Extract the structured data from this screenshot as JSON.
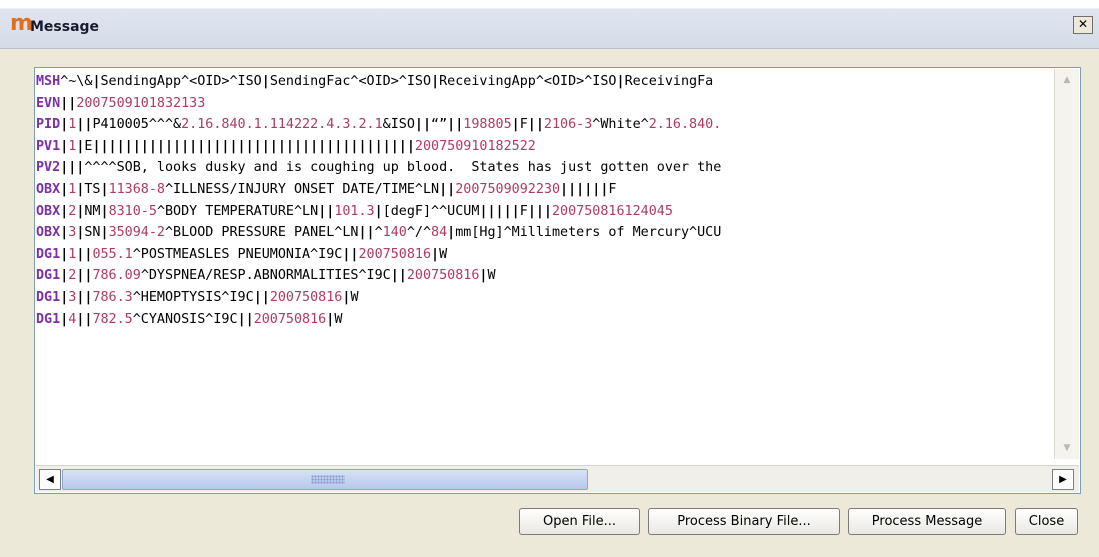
{
  "window": {
    "title": "Message",
    "app_glyph": "m",
    "close_glyph": "✕"
  },
  "message_lines": [
    {
      "seg": "MSH",
      "parts": [
        [
          "t",
          "^~\\&"
        ],
        [
          "s",
          "|"
        ],
        [
          "t",
          "SendingApp^<OID>^ISO"
        ],
        [
          "s",
          "|"
        ],
        [
          "t",
          "SendingFac^<OID>^ISO"
        ],
        [
          "s",
          "|"
        ],
        [
          "t",
          "ReceivingApp^<OID>^ISO"
        ],
        [
          "s",
          "|"
        ],
        [
          "t",
          "ReceivingFa"
        ]
      ]
    },
    {
      "seg": "EVN",
      "parts": [
        [
          "s",
          "||"
        ],
        [
          "n",
          "2007509101832133"
        ]
      ]
    },
    {
      "seg": "PID",
      "parts": [
        [
          "s",
          "|"
        ],
        [
          "n",
          "1"
        ],
        [
          "s",
          "||"
        ],
        [
          "t",
          "P410005^^^&"
        ],
        [
          "n",
          "2.16.840.1.114222.4.3.2.1"
        ],
        [
          "t",
          "&ISO"
        ],
        [
          "s",
          "||"
        ],
        [
          "t",
          "“”"
        ],
        [
          "s",
          "||"
        ],
        [
          "n",
          "198805"
        ],
        [
          "s",
          "|"
        ],
        [
          "t",
          "F"
        ],
        [
          "s",
          "||"
        ],
        [
          "n",
          "2106-3"
        ],
        [
          "t",
          "^White^"
        ],
        [
          "n",
          "2.16.840."
        ]
      ]
    },
    {
      "seg": "PV1",
      "parts": [
        [
          "s",
          "|"
        ],
        [
          "n",
          "1"
        ],
        [
          "s",
          "|"
        ],
        [
          "t",
          "E"
        ],
        [
          "s",
          "||||||||||||||||||||||||||||||||||||||||"
        ],
        [
          "n",
          "200750910182522"
        ]
      ]
    },
    {
      "seg": "PV2",
      "parts": [
        [
          "s",
          "|||"
        ],
        [
          "t",
          "^^^^SOB, looks dusky and is coughing up blood.  States has just gotten over the"
        ]
      ]
    },
    {
      "seg": "OBX",
      "parts": [
        [
          "s",
          "|"
        ],
        [
          "n",
          "1"
        ],
        [
          "s",
          "|"
        ],
        [
          "t",
          "TS"
        ],
        [
          "s",
          "|"
        ],
        [
          "n",
          "11368-8"
        ],
        [
          "t",
          "^ILLNESS/INJURY ONSET DATE/TIME^LN"
        ],
        [
          "s",
          "||"
        ],
        [
          "n",
          "2007509092230"
        ],
        [
          "s",
          "||||||"
        ],
        [
          "t",
          "F"
        ]
      ]
    },
    {
      "seg": "OBX",
      "parts": [
        [
          "s",
          "|"
        ],
        [
          "n",
          "2"
        ],
        [
          "s",
          "|"
        ],
        [
          "t",
          "NM"
        ],
        [
          "s",
          "|"
        ],
        [
          "n",
          "8310-5"
        ],
        [
          "t",
          "^BODY TEMPERATURE^LN"
        ],
        [
          "s",
          "||"
        ],
        [
          "n",
          "101.3"
        ],
        [
          "s",
          "|"
        ],
        [
          "t",
          "[degF]^^UCUM"
        ],
        [
          "s",
          "|||||"
        ],
        [
          "t",
          "F"
        ],
        [
          "s",
          "|||"
        ],
        [
          "n",
          "200750816124045"
        ]
      ]
    },
    {
      "seg": "OBX",
      "parts": [
        [
          "s",
          "|"
        ],
        [
          "n",
          "3"
        ],
        [
          "s",
          "|"
        ],
        [
          "t",
          "SN"
        ],
        [
          "s",
          "|"
        ],
        [
          "n",
          "35094-2"
        ],
        [
          "t",
          "^BLOOD PRESSURE PANEL^LN"
        ],
        [
          "s",
          "||"
        ],
        [
          "t",
          "^"
        ],
        [
          "n",
          "140"
        ],
        [
          "t",
          "^/^"
        ],
        [
          "n",
          "84"
        ],
        [
          "s",
          "|"
        ],
        [
          "t",
          "mm[Hg]^Millimeters of Mercury^UCU"
        ]
      ]
    },
    {
      "seg": "DG1",
      "parts": [
        [
          "s",
          "|"
        ],
        [
          "n",
          "1"
        ],
        [
          "s",
          "||"
        ],
        [
          "n",
          "055.1"
        ],
        [
          "t",
          "^POSTMEASLES PNEUMONIA^I9C"
        ],
        [
          "s",
          "||"
        ],
        [
          "n",
          "200750816"
        ],
        [
          "s",
          "|"
        ],
        [
          "t",
          "W"
        ]
      ]
    },
    {
      "seg": "DG1",
      "parts": [
        [
          "s",
          "|"
        ],
        [
          "n",
          "2"
        ],
        [
          "s",
          "||"
        ],
        [
          "n",
          "786.09"
        ],
        [
          "t",
          "^DYSPNEA/RESP.ABNORMALITIES^I9C"
        ],
        [
          "s",
          "||"
        ],
        [
          "n",
          "200750816"
        ],
        [
          "s",
          "|"
        ],
        [
          "t",
          "W"
        ]
      ]
    },
    {
      "seg": "DG1",
      "parts": [
        [
          "s",
          "|"
        ],
        [
          "n",
          "3"
        ],
        [
          "s",
          "||"
        ],
        [
          "n",
          "786.3"
        ],
        [
          "t",
          "^HEMOPTYSIS^I9C"
        ],
        [
          "s",
          "||"
        ],
        [
          "n",
          "200750816"
        ],
        [
          "s",
          "|"
        ],
        [
          "t",
          "W"
        ]
      ]
    },
    {
      "seg": "DG1",
      "parts": [
        [
          "s",
          "|"
        ],
        [
          "n",
          "4"
        ],
        [
          "s",
          "||"
        ],
        [
          "n",
          "782.5"
        ],
        [
          "t",
          "^CYANOSIS^I9C"
        ],
        [
          "s",
          "||"
        ],
        [
          "n",
          "200750816"
        ],
        [
          "s",
          "|"
        ],
        [
          "t",
          "W"
        ]
      ]
    }
  ],
  "colors": {
    "segment": "#7b2fa8",
    "number": "#b03a60",
    "text": "#000000"
  },
  "scroll": {
    "up_glyph": "▲",
    "down_glyph": "▼",
    "left_glyph": "◀",
    "right_glyph": "▶"
  },
  "buttons": {
    "open_file": "Open File...",
    "process_binary": "Process Binary File...",
    "process_message": "Process Message",
    "close": "Close"
  }
}
